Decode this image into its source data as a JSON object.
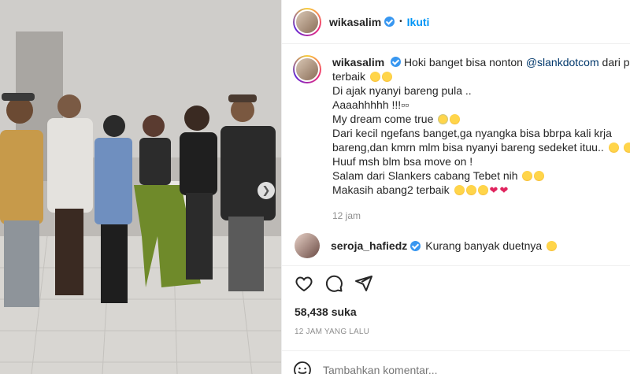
{
  "post": {
    "username": "wikasalim",
    "dot": "•",
    "follow_label": "Ikuti"
  },
  "caption": {
    "username": "wikasalim",
    "line1_prefix": "Hoki banget bisa nonton ",
    "mention": "@slankdotcom",
    "line1_suffix": " dari pos",
    "line2": "terbaik",
    "line3": "Di ajak nyanyi bareng pula ..",
    "line4": "Aaaahhhhh !!!▫▫",
    "line5": "My dream come true",
    "line6": "Dari kecil ngefans banget,ga nyangka bisa bbrpa kali krja",
    "line7": "bareng,dan kmrn mlm bisa nyanyi bareng sedeket ituu..",
    "line8": "Huuf msh blm bsa move on !",
    "line9": "Salam dari Slankers cabang Tebet nih",
    "line10": "Makasih abang2 terbaik",
    "time": "12 jam"
  },
  "comment": {
    "username": "seroja_hafiedz",
    "text": "Kurang banyak duetnya"
  },
  "actions": {
    "like_icon": "heart-icon",
    "comment_icon": "comment-icon",
    "share_icon": "share-icon"
  },
  "likes": "58,438 suka",
  "posted_ago": "12 JAM YANG LALU",
  "add_comment": {
    "placeholder": "Tambahkan komentar..."
  },
  "colors": {
    "accent": "#0095f6",
    "verified": "#3897f0",
    "heart": "#e0245e"
  }
}
